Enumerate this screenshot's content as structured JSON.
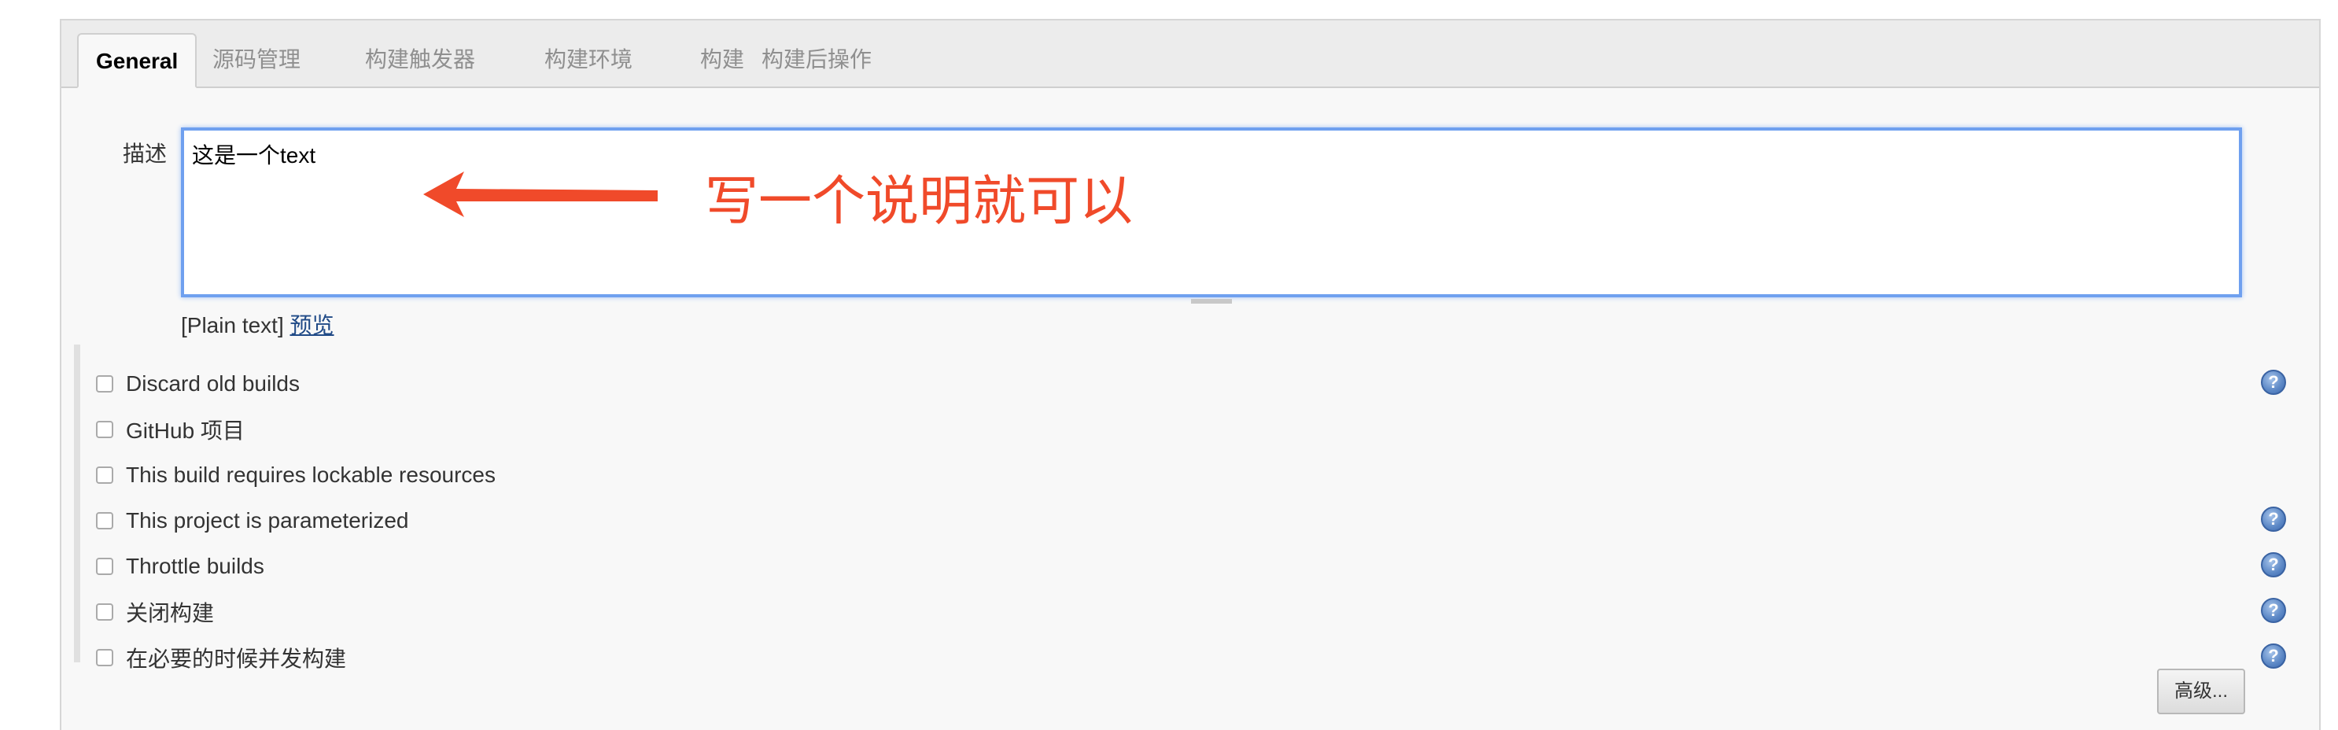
{
  "tabs": [
    "General",
    "源码管理",
    "构建触发器",
    "构建环境",
    "构建",
    "构建后操作"
  ],
  "description": {
    "label": "描述",
    "value": "这是一个text",
    "format_prefix": "[Plain text]",
    "preview_link": "预览"
  },
  "annotation": {
    "text": "写一个说明就可以",
    "color": "#f04a2a"
  },
  "options": [
    {
      "label": "Discard old builds",
      "checked": false
    },
    {
      "label": "GitHub 项目",
      "checked": false
    },
    {
      "label": "This build requires lockable resources",
      "checked": false
    },
    {
      "label": "This project is parameterized",
      "checked": false
    },
    {
      "label": "Throttle builds",
      "checked": false
    },
    {
      "label": "关闭构建",
      "checked": false
    },
    {
      "label": "在必要的时候并发构建",
      "checked": false
    }
  ],
  "help_icon": "?",
  "advanced_button": "高级..."
}
